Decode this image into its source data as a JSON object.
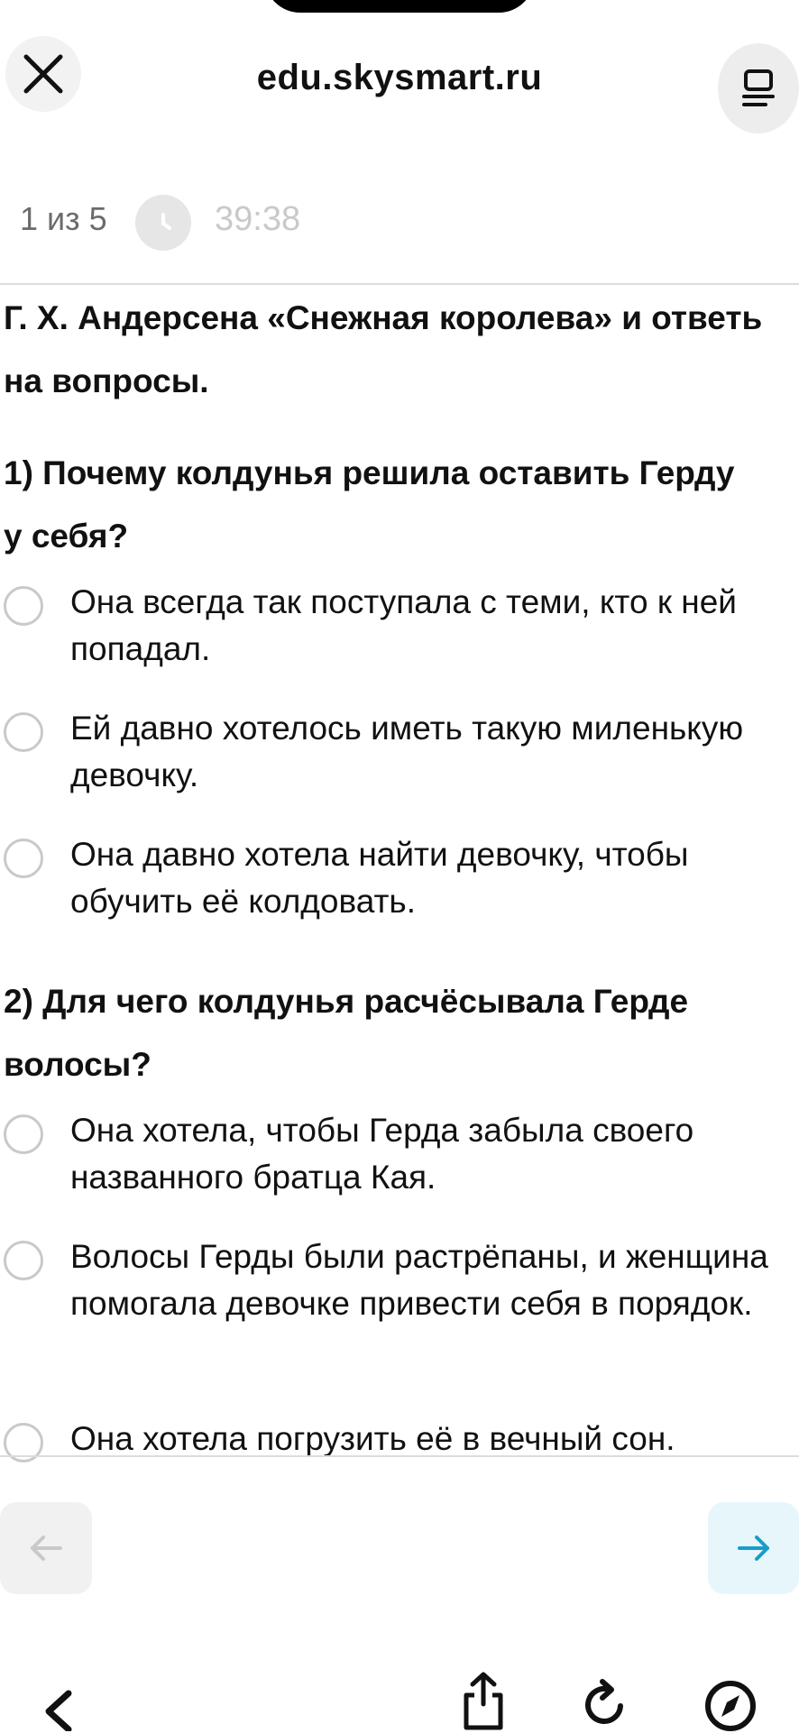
{
  "browser": {
    "url": "edu.skysmart.ru"
  },
  "quiz": {
    "progress": "1 из 5",
    "timer": "39:38"
  },
  "content": {
    "intro_line1": "Г. Х. Андерсена «Снежная королева» и ответь",
    "intro_line2": "на вопросы.",
    "questions": [
      {
        "line1": "1) Почему колдунья решила оставить Герду",
        "line2": "у себя?",
        "options": [
          {
            "label": "Она всегда так поступала с теми, кто к ней попадал."
          },
          {
            "label": "Ей давно хотелось иметь такую миленькую девочку."
          },
          {
            "label": "Она давно хотела найти девочку, чтобы обучить её колдовать."
          }
        ]
      },
      {
        "line1": "2) Для чего колдунья расчёсывала Герде",
        "line2": "волосы?",
        "options": [
          {
            "label": "Она хотела, чтобы Герда забыла своего названного братца Кая."
          },
          {
            "label": "Волосы Герды были растрёпаны, и женщина помогала девочке привести себя в порядок."
          },
          {
            "label": "Она хотела погрузить её в вечный сон."
          }
        ]
      }
    ]
  },
  "icons": {
    "close": "close-icon",
    "menu": "reader-menu-icon",
    "timer": "clock-icon",
    "prev": "arrow-left-icon",
    "next": "arrow-right-icon",
    "back": "chevron-left-icon",
    "share": "share-icon",
    "reload": "reload-icon",
    "compass": "compass-icon"
  },
  "colors": {
    "accent": "#1a9cc9",
    "next_button_bg": "#e7f6fb",
    "muted": "#c9c9c9"
  }
}
